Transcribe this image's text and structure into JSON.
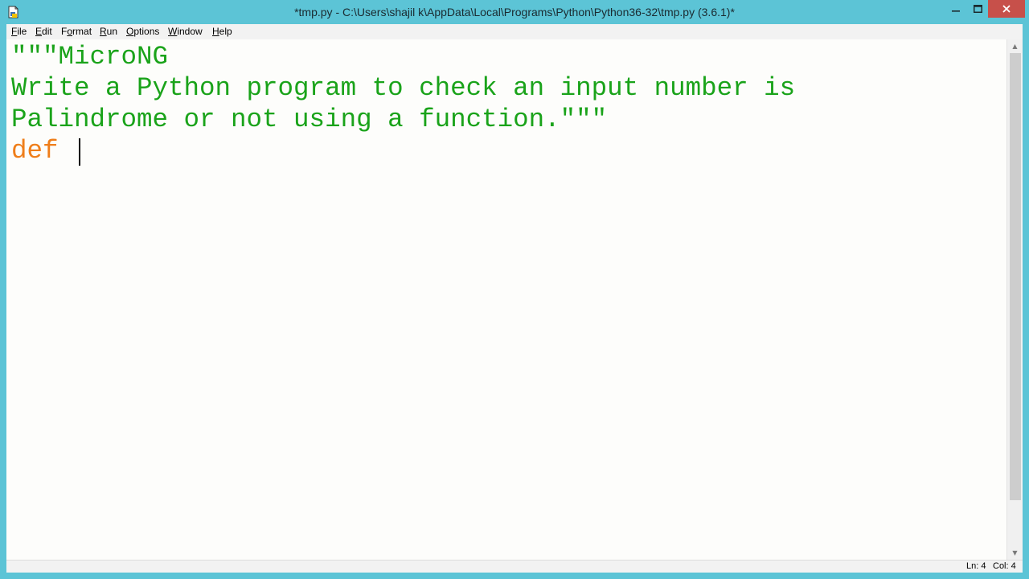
{
  "window": {
    "title": "*tmp.py - C:\\Users\\shajil k\\AppData\\Local\\Programs\\Python\\Python36-32\\tmp.py (3.6.1)*",
    "app_icon": "idle-document-icon",
    "controls": {
      "minimize": "minimize-icon",
      "maximize": "maximize-icon",
      "close": "close-icon"
    },
    "colors": {
      "frame": "#5cc4d6",
      "close_button": "#c7504a"
    }
  },
  "menu": {
    "items": [
      {
        "pre": "",
        "u": "F",
        "post": "ile"
      },
      {
        "pre": "",
        "u": "E",
        "post": "dit"
      },
      {
        "pre": "F",
        "u": "o",
        "post": "rmat"
      },
      {
        "pre": "",
        "u": "R",
        "post": "un"
      },
      {
        "pre": "",
        "u": "O",
        "post": "ptions"
      },
      {
        "pre": "",
        "u": "W",
        "post": "indow"
      },
      {
        "pre": "",
        "u": "H",
        "post": "elp"
      }
    ]
  },
  "editor": {
    "lines": [
      {
        "text": "\"\"\"MicroNG",
        "type": "string"
      },
      {
        "text": "Write a Python program to check an input number is",
        "type": "string"
      },
      {
        "text": "Palindrome or not using a function.\"\"\"",
        "type": "string"
      },
      {
        "keyword": "def",
        "rest": " ",
        "type": "code"
      }
    ],
    "colors": {
      "string": "#1aa31a",
      "keyword": "#ef7e1a",
      "background": "#fdfdfb"
    }
  },
  "status": {
    "line": "Ln: 4",
    "col": "Col: 4"
  }
}
